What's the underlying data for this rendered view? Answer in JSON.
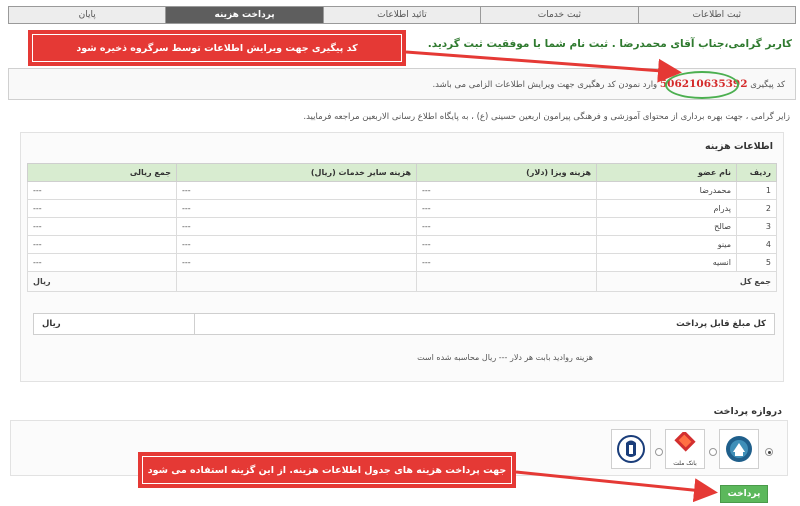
{
  "steps": [
    "ثبت اطلاعات",
    "ثبت خدمات",
    "تائید اطلاعات",
    "پرداخت هزینه",
    "پایان"
  ],
  "active_step": "پرداخت هزینه",
  "welcome": "کاربر گرامی،جناب آقای محمدرضا . ثبت نام شما با موفقیت ثبت گردید.",
  "tracking": {
    "prefix": "کد پیگیری",
    "code": "506210635392",
    "suffix": "وارد نمودن کد رهگیری جهت ویرایش اطلاعات الزامی می باشد."
  },
  "info_line": "زایر گرامی ، جهت بهره برداری از محتوای آموزشی و فرهنگی پیرامون اربعین حسینی (ع) ، به پایگاه اطلاع رسانی الاربعین مراجعه فرمایید.",
  "cost_panel": {
    "title": "اطلاعات هزینه",
    "headers": [
      "ردیف",
      "نام عضو",
      "هزینه ویزا (دلار)",
      "هزینه سایر خدمات (ریال)",
      "جمع ریالی"
    ],
    "rows": [
      {
        "idx": "1",
        "name": "محمدرضا",
        "visa": "---",
        "services": "---",
        "total": "---"
      },
      {
        "idx": "2",
        "name": "پدرام",
        "visa": "---",
        "services": "---",
        "total": "---"
      },
      {
        "idx": "3",
        "name": "صالح",
        "visa": "---",
        "services": "---",
        "total": "---"
      },
      {
        "idx": "4",
        "name": "مینو",
        "visa": "---",
        "services": "---",
        "total": "---"
      },
      {
        "idx": "5",
        "name": "انسیه",
        "visa": "---",
        "services": "---",
        "total": "---"
      }
    ],
    "sum_label": "جمع کل",
    "sum_value": "ریال",
    "payable_label": "کل مبلغ قابل پرداخت",
    "payable_value": "ریال",
    "rate_note": "هزینه روادید بابت هر دلار --- ریال محاسبه شده است"
  },
  "gateway": {
    "title": "دروازه پرداخت",
    "banks": [
      {
        "name": "bank-melli-logo",
        "selected": true
      },
      {
        "name": "bank-mellat-logo",
        "label": "بانک ملت",
        "selected": false
      },
      {
        "name": "bank-saderat-logo",
        "selected": false
      }
    ],
    "pay_button": "پرداخت"
  },
  "callouts": {
    "top": "کد پیگیری جهت ویرایش اطلاعات توسط سرگروه ذخیره شود",
    "bottom": "جهت پرداخت هزینه های جدول اطلاعات هزینه. از این گزینه استفاده می شود"
  },
  "colors": {
    "callout": "#e53935",
    "tracking_code": "#d42a2a",
    "welcome_text": "#2f7a2f",
    "table_header": "#d8ecd0",
    "pay_button": "#5cb85c",
    "active_step": "#5e5e5e"
  }
}
